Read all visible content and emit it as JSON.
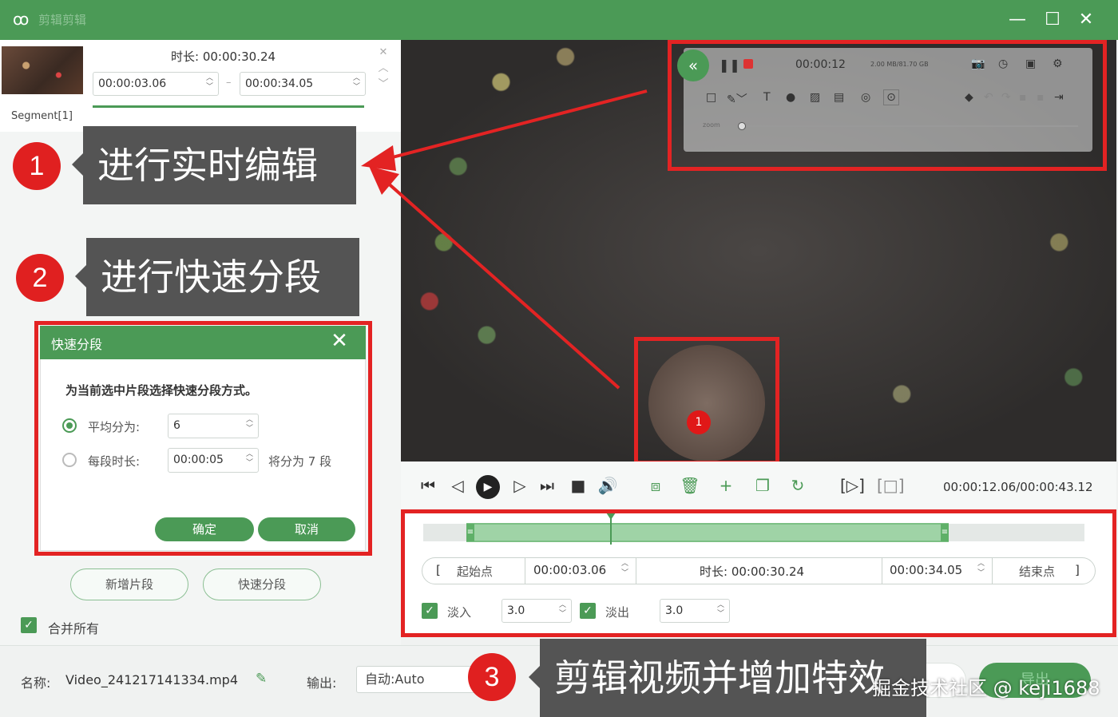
{
  "app": {
    "title": "剪辑剪辑",
    "window_buttons": {
      "minimize": "—",
      "maximize": "☐",
      "close": "✕"
    }
  },
  "segment": {
    "label": "Segment[1]",
    "duration_label": "时长: 00:00:30.24",
    "start_value": "00:00:03.06",
    "end_value": "00:00:34.05",
    "dash": "–"
  },
  "callouts": [
    {
      "number": "1",
      "text": "进行实时编辑"
    },
    {
      "number": "2",
      "text": "进行快速分段"
    },
    {
      "number": "3",
      "text": "剪辑视频并增加特效"
    }
  ],
  "dialog": {
    "title": "快速分段",
    "message": "为当前选中片段选择快速分段方式。",
    "option_equal_label": "平均分为:",
    "option_equal_value": "6",
    "option_length_label": "每段时长:",
    "option_length_value": "00:00:05",
    "option_length_note": "将分为 7 段",
    "confirm_label": "确定",
    "cancel_label": "取消"
  },
  "left_actions": {
    "add_segment": "新增片段",
    "quick_split": "快速分段",
    "merge_all": "合并所有"
  },
  "recorder_toolbar": {
    "time": "00:00:12",
    "size_info": "2.00 MB/81.70 GB",
    "zoom_label": "zoom"
  },
  "player": {
    "time_readout": "00:00:12.06/00:00:43.12",
    "bulb_label": "1"
  },
  "range": {
    "start_bracket": "[",
    "start_label": "起始点",
    "start_value": "00:00:03.06",
    "duration_label": "时长: 00:00:30.24",
    "end_value": "00:00:34.05",
    "end_label": "结束点",
    "end_bracket": "]"
  },
  "fades": {
    "fade_in_label": "淡入",
    "fade_in_value": "3.0",
    "fade_out_label": "淡出",
    "fade_out_value": "3.0"
  },
  "output": {
    "name_label": "名称:",
    "name_value": "Video_241217141334.mp4",
    "output_label": "输出:",
    "output_value": "自动:Auto",
    "export_label": "导出"
  },
  "watermark": "掘金技术社区 @ keji1688",
  "colors": {
    "brand": "#4b9a56",
    "highlight": "#e32323",
    "callout_bg": "#545454"
  }
}
